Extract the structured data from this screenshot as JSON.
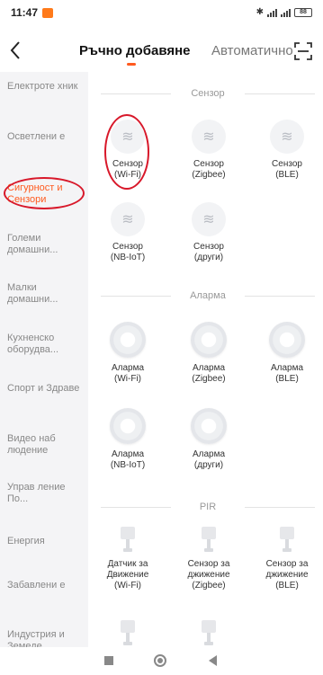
{
  "status_bar": {
    "time": "11:47",
    "bluetooth_icon": "bluetooth-icon",
    "battery": "88"
  },
  "header": {
    "back_icon": "chevron-left-icon",
    "tab_manual": "Ръчно добавяне",
    "tab_auto": "Автоматично",
    "scan_icon": "scan-icon",
    "accent_color": "#ff5a1f"
  },
  "sidebar": {
    "items": [
      {
        "label": "Електроте хник",
        "active": false
      },
      {
        "label": "Осветлени е",
        "active": false
      },
      {
        "label": "Сигурност и Сензори",
        "active": true
      },
      {
        "label": "Големи домашни...",
        "active": false
      },
      {
        "label": "Малки домашни...",
        "active": false
      },
      {
        "label": "Кухненско оборудва...",
        "active": false
      },
      {
        "label": "Спорт и Здраве",
        "active": false
      },
      {
        "label": "Видео наб людение",
        "active": false
      },
      {
        "label": "Управ ление По...",
        "active": false
      },
      {
        "label": "Енергия",
        "active": false
      },
      {
        "label": "Забавлени е",
        "active": false
      },
      {
        "label": "Индустрия и Земеде...",
        "active": false
      }
    ]
  },
  "sections": [
    {
      "title": "Сензор",
      "devices": [
        {
          "line1": "Сензор",
          "line2": "(Wi-Fi)",
          "icon": "sensor-wave-icon"
        },
        {
          "line1": "Сензор",
          "line2": "(Zigbee)",
          "icon": "sensor-wave-icon"
        },
        {
          "line1": "Сензор",
          "line2": "(BLE)",
          "icon": "sensor-wave-icon"
        },
        {
          "line1": "Сензор",
          "line2": "(NB-IoT)",
          "icon": "sensor-wave-icon"
        },
        {
          "line1": "Сензор",
          "line2": "(други)",
          "icon": "sensor-wave-icon"
        }
      ]
    },
    {
      "title": "Аларма",
      "devices": [
        {
          "line1": "Аларма",
          "line2": "(Wi-Fi)",
          "icon": "alarm-icon"
        },
        {
          "line1": "Аларма",
          "line2": "(Zigbee)",
          "icon": "alarm-icon"
        },
        {
          "line1": "Аларма",
          "line2": "(BLE)",
          "icon": "alarm-icon"
        },
        {
          "line1": "Аларма",
          "line2": "(NB-IoT)",
          "icon": "alarm-icon"
        },
        {
          "line1": "Аларма",
          "line2": "(други)",
          "icon": "alarm-icon"
        }
      ]
    },
    {
      "title": "PIR",
      "devices": [
        {
          "line1": "Датчик за",
          "line2": "Движение",
          "line3": "(Wi-Fi)",
          "icon": "pir-sensor-icon"
        },
        {
          "line1": "Сензор за",
          "line2": "джижение",
          "line3": "(Zigbee)",
          "icon": "pir-sensor-icon"
        },
        {
          "line1": "Сензор за",
          "line2": "джижение",
          "line3": "(BLE)",
          "icon": "pir-sensor-icon"
        }
      ]
    }
  ],
  "nav_bar": {
    "recents_icon": "square-icon",
    "home_icon": "circle-icon",
    "back_icon": "triangle-back-icon"
  }
}
